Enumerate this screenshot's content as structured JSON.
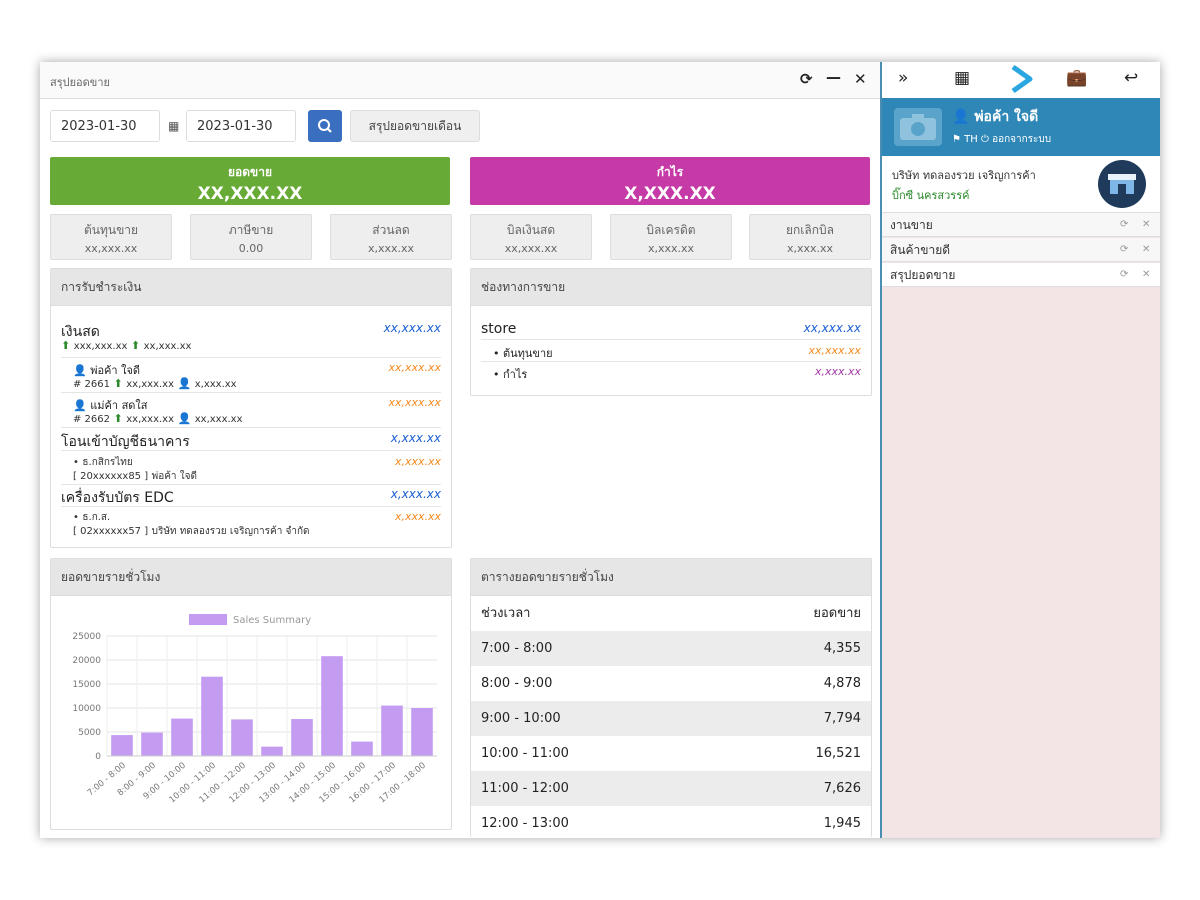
{
  "window": {
    "title": "สรุปยอดขาย"
  },
  "toolbar": {
    "date_from": "2023-01-30",
    "date_to": "2023-01-30",
    "monthly_label": "สรุปยอดขายเดือน"
  },
  "summary": {
    "sales": {
      "label": "ยอดขาย",
      "value": "XX,XXX.XX"
    },
    "profit": {
      "label": "กำไร",
      "value": "X,XXX.XX"
    },
    "cards": [
      {
        "label": "ต้นทุนขาย",
        "value": "xx,xxx.xx"
      },
      {
        "label": "ภาษีขาย",
        "value": "0.00"
      },
      {
        "label": "ส่วนลด",
        "value": "x,xxx.xx"
      },
      {
        "label": "บิลเงินสด",
        "value": "xx,xxx.xx"
      },
      {
        "label": "บิลเครดิต",
        "value": "x,xxx.xx"
      },
      {
        "label": "ยกเลิกบิล",
        "value": "x,xxx.xx"
      }
    ]
  },
  "payments": {
    "title": "การรับชำระเงิน",
    "cash": {
      "label": "เงินสด",
      "total": "xx,xxx.xx",
      "in": "xxx,xxx.xx",
      "out": "xx,xxx.xx"
    },
    "cashiers": [
      {
        "name": "พ่อค้า ใจดี",
        "id": "# 2661",
        "in": "xx,xxx.xx",
        "out": "x,xxx.xx",
        "total": "xx,xxx.xx"
      },
      {
        "name": "แม่ค้า สดใส",
        "id": "# 2662",
        "in": "xx,xxx.xx",
        "out": "xx,xxx.xx",
        "total": "xx,xxx.xx"
      }
    ],
    "transfer": {
      "label": "โอนเข้าบัญชีธนาคาร",
      "total": "x,xxx.xx",
      "bank": "ธ.กสิกรไทย",
      "account": "[ 20xxxxxx85 ]",
      "holder": "พ่อค้า ใจดี",
      "amount": "x,xxx.xx"
    },
    "edc": {
      "label": "เครื่องรับบัตร EDC",
      "total": "x,xxx.xx",
      "bank": "ธ.ก.ส.",
      "account": "[ 02xxxxxx57 ]",
      "holder": "บริษัท ทดลองรวย เจริญการค้า จำกัด",
      "amount": "x,xxx.xx"
    }
  },
  "channels": {
    "title": "ช่องทางการขาย",
    "store": {
      "label": "store",
      "total": "xx,xxx.xx"
    },
    "items": [
      {
        "label": "ต้นทุนขาย",
        "value": "xx,xxx.xx"
      },
      {
        "label": "กำไร",
        "value": "x,xxx.xx"
      }
    ]
  },
  "hourly_chart": {
    "title": "ยอดขายรายชั่วโมง",
    "chart_data": {
      "type": "bar",
      "categories": [
        "7:00 - 8:00",
        "8:00 - 9:00",
        "9:00 - 10:00",
        "10:00 - 11:00",
        "11:00 - 12:00",
        "12:00 - 13:00",
        "13:00 - 14:00",
        "14:00 - 15:00",
        "15:00 - 16:00",
        "16:00 - 17:00",
        "17:00 - 18:00"
      ],
      "series": [
        {
          "name": "Sales Summary",
          "values": [
            4355,
            4878,
            7794,
            16521,
            7626,
            1945,
            7700,
            20800,
            3000,
            10500,
            10000
          ]
        }
      ],
      "yticks": [
        "0",
        "5000",
        "10000",
        "15000",
        "20000",
        "25000"
      ],
      "ylim": [
        0,
        25000
      ],
      "grid": true,
      "legend": "top",
      "bar_color": "#c39cf2"
    }
  },
  "hourly_table": {
    "title": "ตารางยอดขายรายชั่วโมง",
    "header": {
      "time": "ช่วงเวลา",
      "sales": "ยอดขาย"
    },
    "rows": [
      {
        "time": "7:00 - 8:00",
        "sales": "4,355"
      },
      {
        "time": "8:00 - 9:00",
        "sales": "4,878"
      },
      {
        "time": "9:00 - 10:00",
        "sales": "7,794"
      },
      {
        "time": "10:00 - 11:00",
        "sales": "16,521"
      },
      {
        "time": "11:00 - 12:00",
        "sales": "7,626"
      },
      {
        "time": "12:00 - 13:00",
        "sales": "1,945"
      }
    ]
  },
  "sidebar": {
    "user": {
      "name": "พ่อค้า ใจดี",
      "lang": "TH",
      "status": "ออกจากระบบ"
    },
    "company": {
      "name": "บริษัท ทดลองรวย เจริญการค้า",
      "branch": "บิ๊กซี นครสวรรค์"
    },
    "tabs": [
      {
        "label": "งานขาย"
      },
      {
        "label": "สินค้าขายดี"
      },
      {
        "label": "สรุปยอดขาย"
      }
    ]
  }
}
